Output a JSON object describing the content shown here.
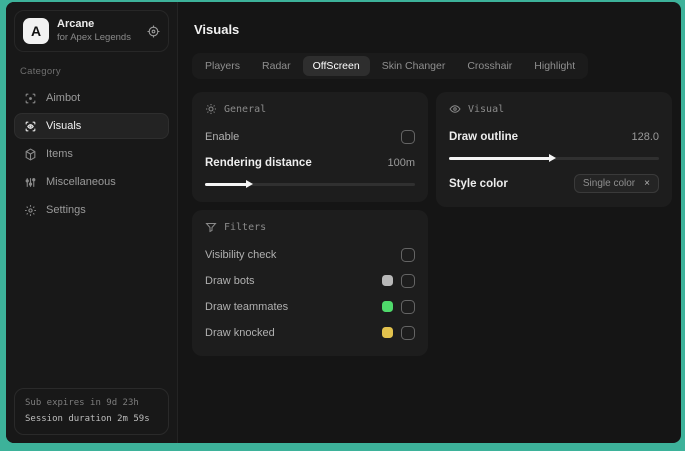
{
  "theme": {
    "desktop_background": "#3db29a",
    "window_background": "#151515",
    "panel_background": "#1d1d1d"
  },
  "sidebar": {
    "logo_letter": "A",
    "app_name": "Arcane",
    "app_subtitle": "for Apex Legends",
    "category_label": "Category",
    "items": [
      {
        "label": "Aimbot",
        "icon": "crosshair-scan-icon",
        "active": false
      },
      {
        "label": "Visuals",
        "icon": "eye-scan-icon",
        "active": true
      },
      {
        "label": "Items",
        "icon": "cube-icon",
        "active": false
      },
      {
        "label": "Miscellaneous",
        "icon": "sliders-icon",
        "active": false
      },
      {
        "label": "Settings",
        "icon": "gear-icon",
        "active": false
      }
    ],
    "footer": {
      "line1": "Sub expires in 9d 23h",
      "line2": "Session duration 2m 59s"
    }
  },
  "main": {
    "title": "Visuals",
    "tabs": [
      {
        "label": "Players",
        "active": false
      },
      {
        "label": "Radar",
        "active": false
      },
      {
        "label": "OffScreen",
        "active": true
      },
      {
        "label": "Skin Changer",
        "active": false
      },
      {
        "label": "Crosshair",
        "active": false
      },
      {
        "label": "Highlight",
        "active": false
      }
    ],
    "general_panel": {
      "title": "General",
      "enable_label": "Enable",
      "rendering_distance_label": "Rendering distance",
      "rendering_distance_value": "100m",
      "slider_fill_percent": 20
    },
    "filters_panel": {
      "title": "Filters",
      "rows": [
        {
          "label": "Visibility check",
          "swatch": null
        },
        {
          "label": "Draw bots",
          "swatch": "#b8b8b8"
        },
        {
          "label": "Draw teammates",
          "swatch": "#4fd96b"
        },
        {
          "label": "Draw knocked",
          "swatch": "#e2c24d"
        }
      ]
    },
    "visual_panel": {
      "title": "Visual",
      "draw_outline_label": "Draw outline",
      "draw_outline_value": "128.0",
      "slider_fill_percent": 48,
      "style_color_label": "Style color",
      "style_color_tag": "Single color",
      "tag_remove_glyph": "×"
    }
  }
}
